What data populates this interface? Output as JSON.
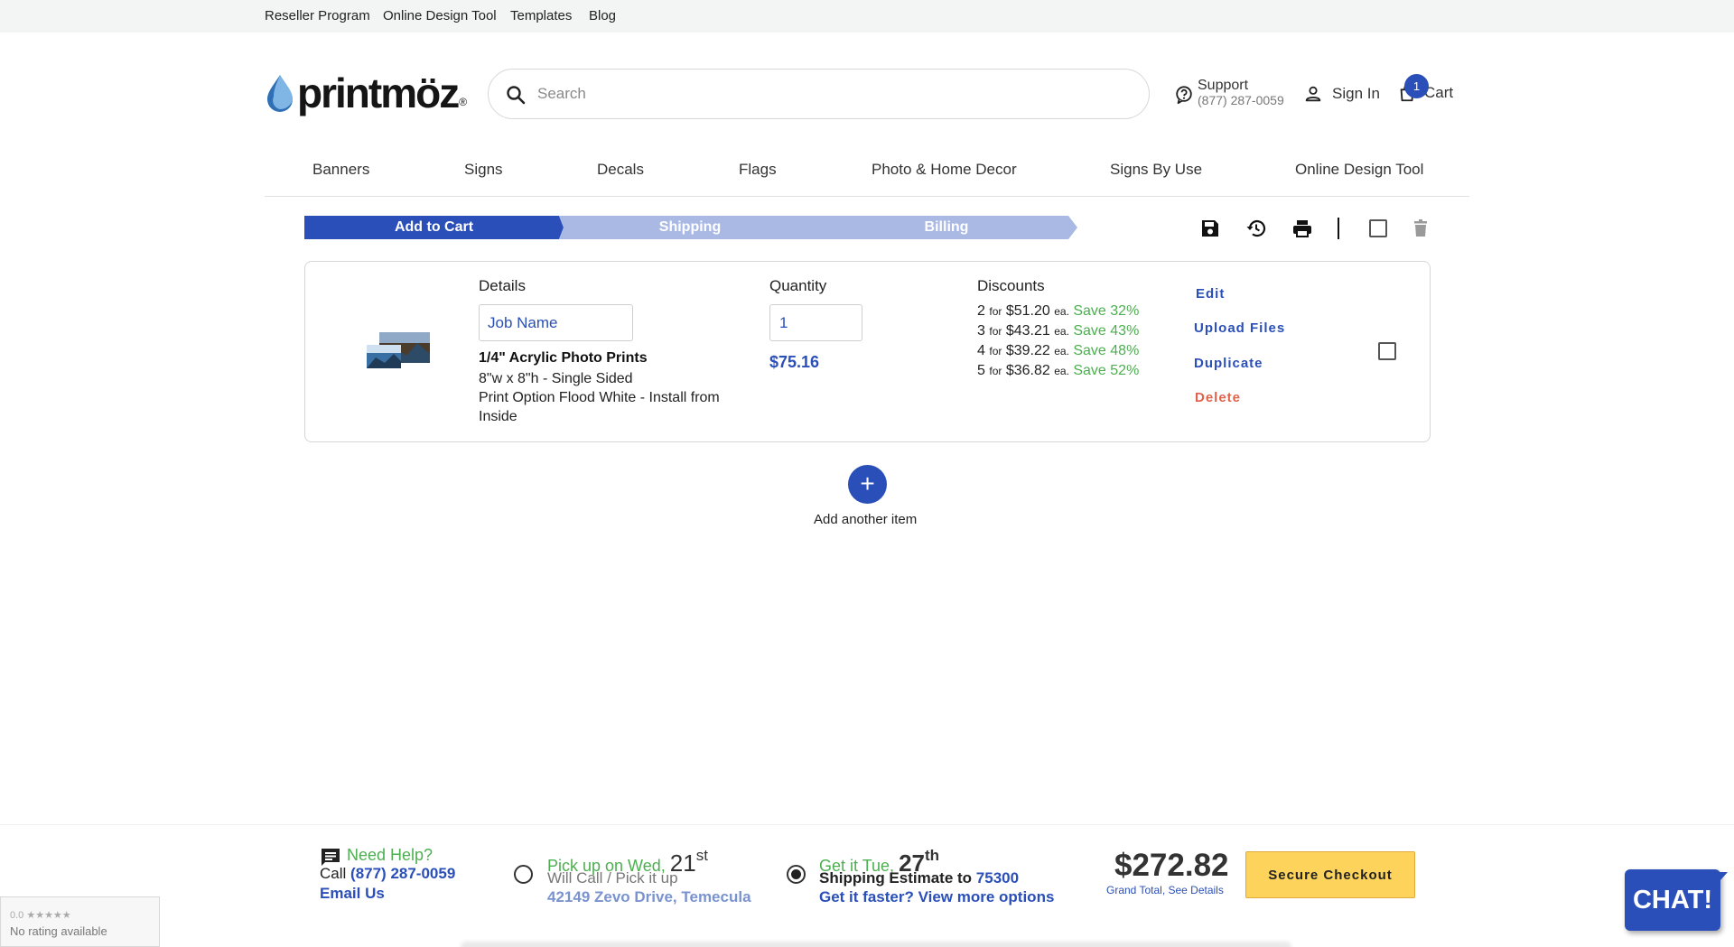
{
  "topbar": {
    "links": [
      "Reseller Program",
      "Online Design Tool",
      "Templates",
      "Blog"
    ]
  },
  "header": {
    "logo_text": "printmöz",
    "logo_reg": "®",
    "search_placeholder": "Search",
    "support_label": "Support",
    "support_phone": "(877) 287-0059",
    "signin_label": "Sign In",
    "cart_label": "Cart",
    "cart_count": "1"
  },
  "nav": {
    "items": [
      "Banners",
      "Signs",
      "Decals",
      "Flags",
      "Photo & Home Decor",
      "Signs By Use",
      "Online Design Tool"
    ]
  },
  "steps": [
    "Add to Cart",
    "Shipping",
    "Billing"
  ],
  "toolbar_icons": [
    "save-icon",
    "history-icon",
    "print-icon",
    "select-all-checkbox",
    "trash-icon"
  ],
  "item": {
    "details_title": "Details",
    "job_name_placeholder": "Job Name",
    "product_name": "1/4\" Acrylic Photo Prints",
    "size_line": "8\"w x 8\"h - Single Sided",
    "option_line": "Print Option Flood White - Install from Inside",
    "quantity_title": "Quantity",
    "quantity_value": "1",
    "price": "$75.16",
    "discounts_title": "Discounts",
    "discounts": [
      {
        "qty": "2",
        "for": "for",
        "price": "$51.20",
        "ea": "ea.",
        "save": "Save 32%"
      },
      {
        "qty": "3",
        "for": "for",
        "price": "$43.21",
        "ea": "ea.",
        "save": "Save 43%"
      },
      {
        "qty": "4",
        "for": "for",
        "price": "$39.22",
        "ea": "ea.",
        "save": "Save 48%"
      },
      {
        "qty": "5",
        "for": "for",
        "price": "$36.82",
        "ea": "ea.",
        "save": "Save 52%"
      }
    ],
    "actions": {
      "edit": "Edit",
      "upload": "Upload Files",
      "duplicate": "Duplicate",
      "delete": "Delete"
    }
  },
  "add_item": {
    "icon": "+",
    "label": "Add another item"
  },
  "footer": {
    "help_title": "Need Help?",
    "call_prefix": "Call",
    "call_phone": "(877) 287-0059",
    "email": "Email Us",
    "pickup": {
      "prefix": "Pick up on Wed,",
      "day": "21",
      "suffix": "st",
      "line2": "Will Call / Pick it up",
      "line3": "42149 Zevo Drive, Temecula",
      "selected": false
    },
    "shipping": {
      "prefix": "Get it Tue,",
      "day": "27",
      "suffix": "th",
      "line2_prefix": "Shipping Estimate to",
      "zip": "75300",
      "line3": "Get it faster? View more options",
      "selected": true
    },
    "grand_total": "$272.82",
    "grand_total_label": "Grand Total, See Details",
    "checkout_label": "Secure Checkout"
  },
  "rating": {
    "stars": "0.0 ★★★★★",
    "text": "No rating available"
  },
  "chat": {
    "label": "CHAT!"
  },
  "colors": {
    "brand_blue": "#2a4fb8",
    "light_blue": "#a9b9e3",
    "save_green": "#4caf50",
    "delete_red": "#e0624a",
    "checkout_yellow": "#fdd35b"
  }
}
